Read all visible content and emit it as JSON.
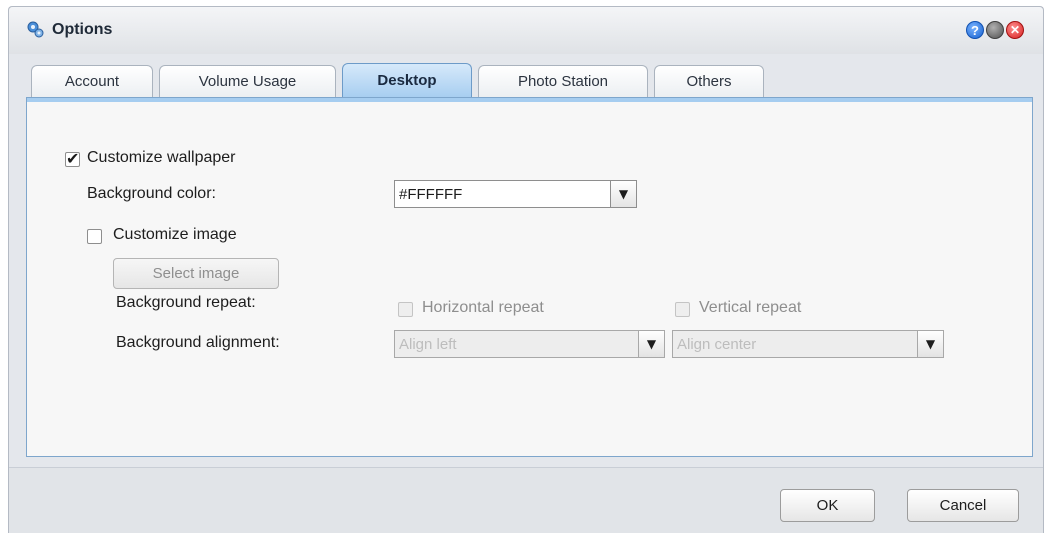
{
  "window": {
    "title": "Options"
  },
  "tabs": [
    {
      "label": "Account",
      "active": false
    },
    {
      "label": "Volume Usage",
      "active": false
    },
    {
      "label": "Desktop",
      "active": true
    },
    {
      "label": "Photo Station",
      "active": false
    },
    {
      "label": "Others",
      "active": false
    }
  ],
  "desktop": {
    "customize_wallpaper": {
      "label": "Customize wallpaper",
      "checked": true
    },
    "background_color": {
      "label": "Background color:",
      "value": "#FFFFFF"
    },
    "customize_image": {
      "label": "Customize image",
      "checked": false
    },
    "select_image_button": "Select image",
    "background_repeat": {
      "label": "Background repeat:",
      "horizontal": {
        "label": "Horizontal repeat",
        "checked": false,
        "enabled": false
      },
      "vertical": {
        "label": "Vertical repeat",
        "checked": false,
        "enabled": false
      }
    },
    "background_alignment": {
      "label": "Background alignment:",
      "horizontal_value": "Align left",
      "vertical_value": "Align center"
    }
  },
  "footer": {
    "ok_label": "OK",
    "cancel_label": "Cancel"
  },
  "colors": {
    "active_tab": "#a6cdf0",
    "panel_border": "#7ea6cc",
    "window_bg": "#e4e7ec"
  },
  "icons": {
    "app": "options-gear-icon",
    "help": "help-icon",
    "minimize": "minimize-icon",
    "close": "close-icon",
    "dropdown": "chevron-down-icon"
  }
}
